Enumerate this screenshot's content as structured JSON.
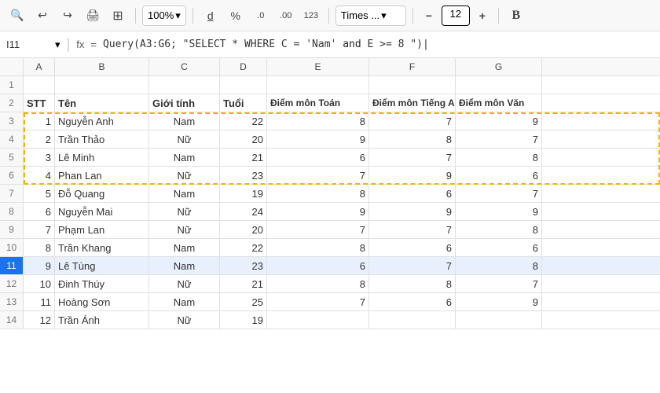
{
  "toolbar": {
    "zoom": "100%",
    "font": "Times ...",
    "font_size": "12",
    "zoom_label": "100%",
    "bold_label": "B"
  },
  "formula_bar": {
    "cell_ref": "I11",
    "fx": "fx",
    "formula": "= Query(A3:G6; \"SELECT * WHERE C = 'Nam' and E >= 8 \")"
  },
  "columns": {
    "letters": [
      "A",
      "B",
      "C",
      "D",
      "E",
      "F",
      "G"
    ],
    "widths": [
      40,
      120,
      90,
      60,
      130,
      110,
      110
    ]
  },
  "rows": [
    {
      "num": "1",
      "cells": [
        "",
        "",
        "",
        "",
        "",
        "",
        ""
      ]
    },
    {
      "num": "2",
      "cells": [
        "STT",
        "Tên",
        "Giới tính",
        "Tuổi",
        "Điểm môn Toán",
        "Điểm môn Tiếng A",
        "Điểm môn Văn"
      ],
      "bold": true
    },
    {
      "num": "3",
      "cells": [
        "1",
        "Nguyễn Anh",
        "Nam",
        "22",
        "8",
        "7",
        "9"
      ],
      "dashed": true
    },
    {
      "num": "4",
      "cells": [
        "2",
        "Trần Thảo",
        "Nữ",
        "20",
        "9",
        "8",
        "7"
      ],
      "dashed": true
    },
    {
      "num": "5",
      "cells": [
        "3",
        "Lê Minh",
        "Nam",
        "21",
        "6",
        "7",
        "8"
      ],
      "dashed": true
    },
    {
      "num": "6",
      "cells": [
        "4",
        "Phan Lan",
        "Nữ",
        "23",
        "7",
        "9",
        "6"
      ],
      "dashed": true
    },
    {
      "num": "7",
      "cells": [
        "5",
        "Đỗ Quang",
        "Nam",
        "19",
        "8",
        "6",
        "7"
      ]
    },
    {
      "num": "8",
      "cells": [
        "6",
        "Nguyễn Mai",
        "Nữ",
        "24",
        "9",
        "9",
        "9"
      ]
    },
    {
      "num": "9",
      "cells": [
        "7",
        "Phạm Lan",
        "Nữ",
        "20",
        "7",
        "7",
        "8"
      ]
    },
    {
      "num": "10",
      "cells": [
        "8",
        "Trần Khang",
        "Nam",
        "22",
        "8",
        "6",
        "6"
      ]
    },
    {
      "num": "11",
      "cells": [
        "9",
        "Lê Tùng",
        "Nam",
        "23",
        "6",
        "7",
        "8"
      ],
      "selected": true
    },
    {
      "num": "12",
      "cells": [
        "10",
        "Đinh Thúy",
        "Nữ",
        "21",
        "8",
        "8",
        "7"
      ]
    },
    {
      "num": "13",
      "cells": [
        "11",
        "Hoàng Sơn",
        "Nam",
        "25",
        "7",
        "6",
        "9"
      ]
    },
    {
      "num": "14",
      "cells": [
        "12",
        "Trần Ánh",
        "Nữ",
        "19",
        "",
        "",
        ""
      ]
    }
  ],
  "icons": {
    "search": "🔍",
    "undo": "↩",
    "redo": "↪",
    "print": "🖨",
    "format": "⊞",
    "underline": "d̲",
    "percent": "%",
    "decimal_left": ".0",
    "decimal_right": ".00",
    "num123": "123",
    "minus": "−",
    "plus": "+",
    "chevron_down": "▾"
  }
}
